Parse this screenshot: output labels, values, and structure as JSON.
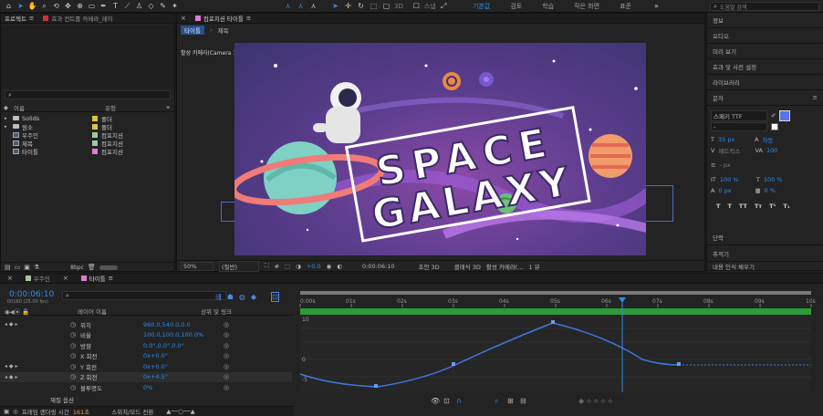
{
  "toolbar": {
    "workspaces": [
      "기본값",
      "검토",
      "학습",
      "작은 화면",
      "표준"
    ],
    "search_placeholder": "도움말 검색",
    "label_3d": "3D",
    "snap_label": "스냅"
  },
  "project": {
    "tab_label": "프로젝트",
    "tab2_label": "효과 컨트롤 카메라_레이",
    "search_placeholder": "",
    "col_name": "이름",
    "col_type": "유형",
    "items": [
      {
        "name": "Solids",
        "type": "폴더",
        "color": "#d9c24a",
        "kind": "folder"
      },
      {
        "name": "원소",
        "type": "폴더",
        "color": "#d9c24a",
        "kind": "folder"
      },
      {
        "name": "우주인",
        "type": "컴포지션",
        "color": "#a0c8a0",
        "kind": "comp"
      },
      {
        "name": "제목",
        "type": "컴포지션",
        "color": "#a0c8a0",
        "kind": "comp"
      },
      {
        "name": "타이틀",
        "type": "컴포지션",
        "color": "#e07ad3",
        "kind": "comp"
      }
    ],
    "bpc": "8bpc"
  },
  "comp": {
    "tab_label": "컴포지션 타이틀",
    "breadcrumb": [
      "타이틀",
      "제목"
    ],
    "camera_label": "활성 카메라(Camera 1)",
    "title_line1": "SPACE",
    "title_line2": "GALAXY",
    "zoom": "50%",
    "resolution": "(절반)",
    "exposure": "+0.0",
    "timecode": "0:00:06:10",
    "renderer": "초안 3D",
    "renderer_mode": "클래식 3D",
    "camera_select": "활성 카메라(...",
    "view_count": "1 뷰"
  },
  "right_panel": {
    "items": [
      "정보",
      "오디오",
      "미리 보기",
      "효과 및 사전 설정",
      "라이브러리"
    ],
    "char_title": "문자",
    "font_family": "스페키 TTF",
    "font_style": "-",
    "font_size": "35 px",
    "tracking_auto": "자동",
    "kerning": "메트릭스",
    "tracking_val": "100",
    "stroke_unit": "- px",
    "vscale": "100 %",
    "hscale": "100 %",
    "baseline": "0 px",
    "tsume": "0 %",
    "style_buttons": [
      "T",
      "T",
      "TT",
      "Tт",
      "T¹",
      "T₁"
    ],
    "para_label": "단락",
    "tracker_label": "추적기",
    "content_aware": "내용 인식 채우기",
    "fill_color": "#5a73e6"
  },
  "timeline": {
    "tabs": [
      {
        "label": "우주인",
        "color": "#a0c8a0"
      },
      {
        "label": "타이틀",
        "color": "#e07ad3"
      }
    ],
    "current_time": "0:00:06:10",
    "frame_info": "00160 (25.00 fps)",
    "search_placeholder": "",
    "col_layer_name": "레이어 이름",
    "col_parent": "상위 및 링크",
    "properties": [
      {
        "label": "위치",
        "value": "960.0,540.0,0.0"
      },
      {
        "label": "비율",
        "value": "100.0,100.0,100.0%"
      },
      {
        "label": "방향",
        "value": "0.0°,0.0°,0.0°"
      },
      {
        "label": "X 회전",
        "value": "0x+0.0°"
      },
      {
        "label": "Y 회전",
        "value": "0x+0.0°"
      },
      {
        "label": "Z 회전",
        "value": "0x+4.5°"
      },
      {
        "label": "불투명도",
        "value": "0%"
      }
    ],
    "material_label": "재질 옵션",
    "footer_render": "프레임 렌더링 시간",
    "footer_render_val": "161초",
    "footer_toggle": "스위치/모드 전환",
    "ruler": [
      "0:00s",
      "01s",
      "02s",
      "03s",
      "04s",
      "05s",
      "06s",
      "07s",
      "08s",
      "09s",
      "10s"
    ],
    "graph_axis": [
      "10",
      "0",
      "-5"
    ]
  }
}
